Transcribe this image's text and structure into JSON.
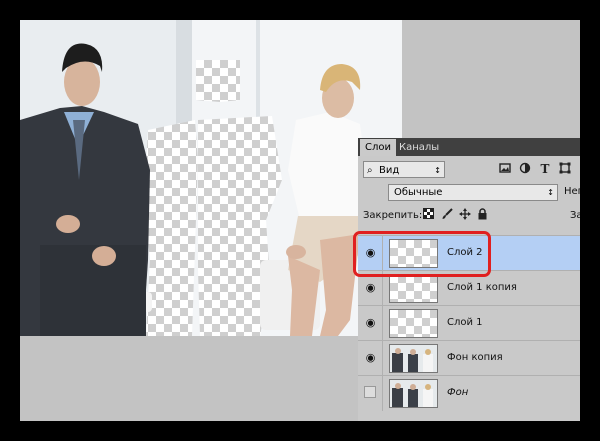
{
  "layers_panel": {
    "tabs": [
      {
        "label": "Слои",
        "active": true
      },
      {
        "label": "Каналы",
        "active": false
      }
    ],
    "filter": {
      "value": "Вид",
      "icon": "search-icon"
    },
    "filter_icons": [
      "image-filter-icon",
      "adjustment-filter-icon",
      "type-filter-icon",
      "shape-filter-icon"
    ],
    "type_icon_glyph": "T",
    "blend_mode": "Обычные",
    "opacity_label": "Непрозрачность:",
    "lock_label": "Закрепить:",
    "lock_icons": [
      "lock-transparent-icon",
      "lock-image-icon",
      "lock-position-icon",
      "lock-all-icon"
    ],
    "fill_label": "Заливка:",
    "layers": [
      {
        "name": "Слой 2",
        "visible": true,
        "selected": true,
        "thumb": "transparent"
      },
      {
        "name": "Слой 1 копия",
        "visible": true,
        "selected": false,
        "thumb": "transparent"
      },
      {
        "name": "Слой 1",
        "visible": true,
        "selected": false,
        "thumb": "transparent"
      },
      {
        "name": "Фон копия",
        "visible": true,
        "selected": false,
        "thumb": "photo"
      },
      {
        "name": "Фон",
        "visible": false,
        "selected": false,
        "thumb": "photo",
        "italic": true
      }
    ]
  },
  "colors": {
    "selected_row": "#b4cff4",
    "highlight": "#e02020",
    "panel_bg": "#c9c9c9"
  }
}
